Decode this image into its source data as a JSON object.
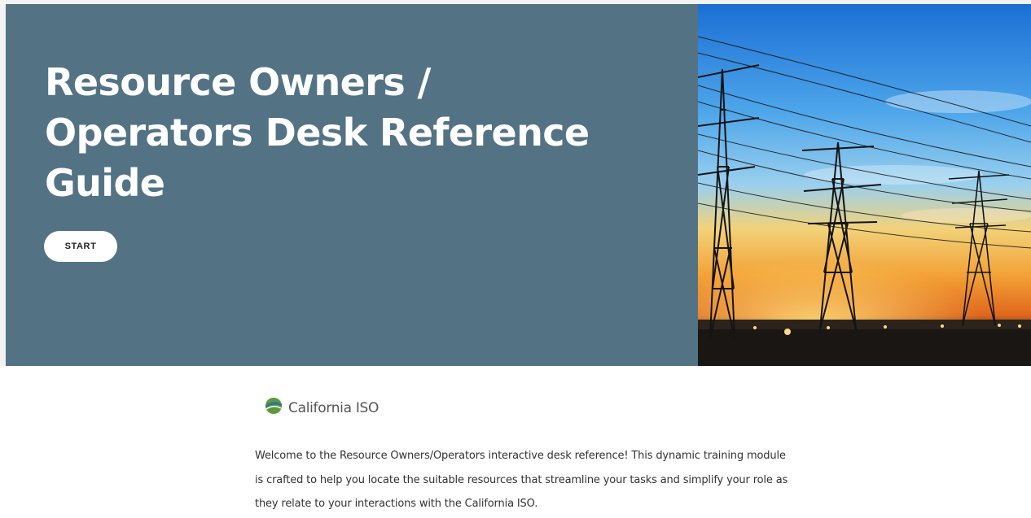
{
  "hero": {
    "title": "Resource Owners / Operators Desk Reference Guide",
    "start_label": "START",
    "background_color": "#537385",
    "image_subject": "power-transmission-towers-sunset"
  },
  "logo": {
    "text": "California ISO",
    "icon": "california-iso-logo-icon"
  },
  "intro": {
    "text": "Welcome to the Resource Owners/Operators interactive desk reference! This dynamic training module is crafted to help you locate the suitable resources that streamline your tasks and simplify your role as they relate to your interactions with the California ISO."
  }
}
